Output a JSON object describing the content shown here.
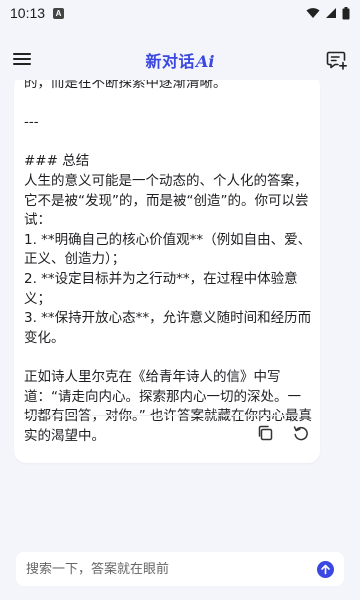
{
  "status_bar": {
    "time": "10:13",
    "notification_letter": "A"
  },
  "header": {
    "title": "新对话",
    "title_suffix": "Ai"
  },
  "message": {
    "cut_top_line": "的，而是在不断探索中逐渐清晰。",
    "separator": "---",
    "heading": "### 总结",
    "summary": "人生的意义可能是一个动态的、个人化的答案，它不是被“发现”的，而是被“创造”的。你可以尝试：",
    "items": [
      "1. **明确自己的核心价值观**（例如自由、爱、正义、创造力）；",
      "2. **设定目标并为之行动**，在过程中体验意义；",
      "3. **保持开放心态**，允许意义随时间和经历而变化。"
    ],
    "closing": "正如诗人里尔克在《给青年诗人的信》中写道：“请走向内心。探索那内心一切的深处。一切都有回答，对你。” 也许答案就藏在你内心最真实的渴望中。"
  },
  "input": {
    "placeholder": "搜索一下，答案就在眼前"
  },
  "colors": {
    "accent": "#3a47e0",
    "background": "#f4f5fa",
    "card": "#ffffff"
  },
  "icons": {
    "menu": "menu-icon",
    "new_chat": "new-chat-icon",
    "copy": "copy-icon",
    "regenerate": "refresh-icon",
    "send": "send-arrow-icon"
  }
}
